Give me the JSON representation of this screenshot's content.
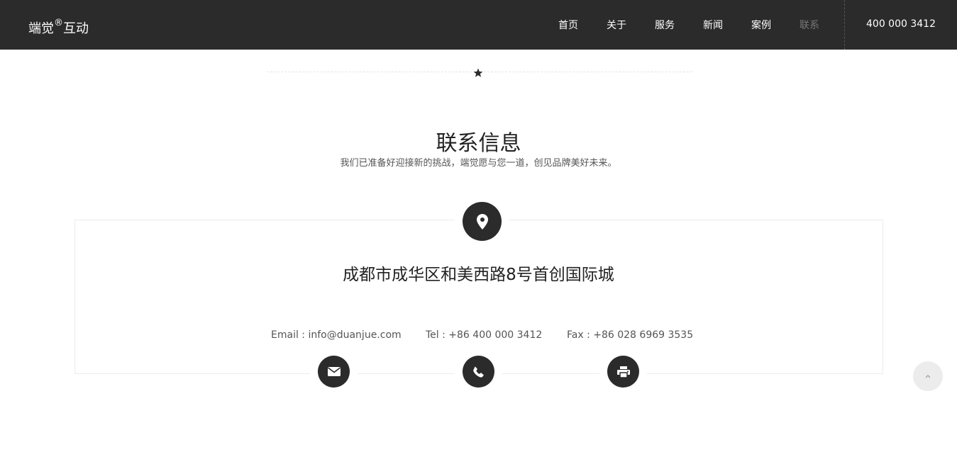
{
  "header": {
    "logo_main": "端觉",
    "logo_reg": "®",
    "logo_sub": "互动",
    "nav": [
      {
        "label": "首页"
      },
      {
        "label": "关于"
      },
      {
        "label": "服务"
      },
      {
        "label": "新闻"
      },
      {
        "label": "案例"
      },
      {
        "label": "联系",
        "active": true
      }
    ],
    "phone": "400 000 3412"
  },
  "section": {
    "title": "联系信息",
    "subtitle": "我们已准备好迎接新的挑战，端觉愿与您一道，创见品牌美好未来。"
  },
  "contact": {
    "address": "成都市成华区和美西路8号首创国际城",
    "email": "Email : info@duanjue.com",
    "tel": "Tel : +86 400 000 3412",
    "fax": "Fax : +86 028 6969 3535"
  },
  "icons": {
    "divider": "star-icon",
    "address": "location-pin-icon",
    "email": "envelope-icon",
    "tel": "phone-icon",
    "fax": "printer-icon",
    "to_top": "chevron-up-icon"
  },
  "colors": {
    "header_bg": "#2b2b2b",
    "nav_active": "#777777",
    "icon_circle": "#2b2b2b"
  }
}
